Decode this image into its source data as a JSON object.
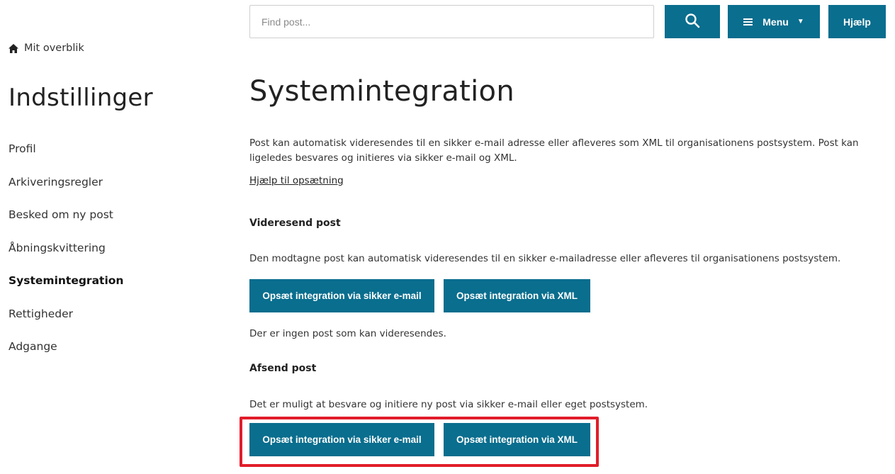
{
  "header": {
    "search_placeholder": "Find post...",
    "menu_label": "Menu",
    "help_label": "Hjælp"
  },
  "breadcrumb": {
    "overview_label": "Mit overblik"
  },
  "sidebar": {
    "title": "Indstillinger",
    "items": [
      {
        "label": "Profil"
      },
      {
        "label": "Arkiveringsregler"
      },
      {
        "label": "Besked om ny post"
      },
      {
        "label": "Åbningskvittering"
      },
      {
        "label": "Systemintegration"
      },
      {
        "label": "Rettigheder"
      },
      {
        "label": "Adgange"
      }
    ],
    "active_index": 4
  },
  "main": {
    "title": "Systemintegration",
    "intro": "Post kan automatisk videresendes til en sikker e-mail adresse eller afleveres som XML til organisationens postsystem. Post kan ligeledes besvares og initieres via sikker e-mail og XML.",
    "help_link": "Hjælp til opsætning",
    "forward": {
      "title": "Videresend post",
      "text": "Den modtagne post kan automatisk videresendes til en sikker e-mailadresse eller afleveres til organisationens postsystem.",
      "email_button": "Opsæt integration via sikker e-mail",
      "xml_button": "Opsæt integration via XML",
      "status": "Der er ingen post som kan videresendes."
    },
    "send": {
      "title": "Afsend post",
      "text": "Det er muligt at besvare og initiere ny post via sikker e-mail eller eget postsystem.",
      "email_button": "Opsæt integration via sikker e-mail",
      "xml_button": "Opsæt integration via XML"
    }
  },
  "colors": {
    "primary": "#0a6e8e",
    "highlight": "#e11d2a"
  }
}
